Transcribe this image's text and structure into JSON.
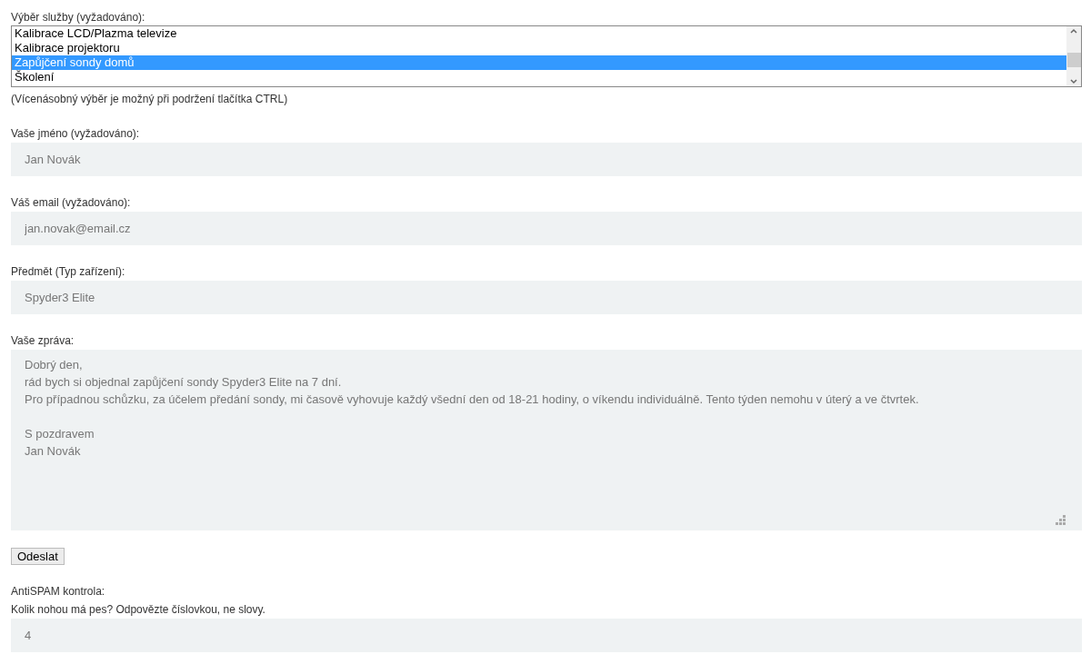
{
  "service_select": {
    "label": "Výběr služby (vyžadováno):",
    "options": [
      {
        "label": "Kalibrace LCD/Plazma televize",
        "selected": false
      },
      {
        "label": "Kalibrace projektoru",
        "selected": false
      },
      {
        "label": "Zapůjčení sondy domů",
        "selected": true
      },
      {
        "label": "Školení",
        "selected": false
      }
    ],
    "hint": "(Vícenásobný výběr je možný při podržení tlačítka CTRL)"
  },
  "fields": [
    {
      "label": "Vaše jméno (vyžadováno):",
      "value": "Jan Novák"
    },
    {
      "label": "Váš email (vyžadováno):",
      "value": "jan.novak@email.cz"
    },
    {
      "label": "Předmět (Typ zařízení):",
      "value": "Spyder3 Elite"
    }
  ],
  "message": {
    "label": "Vaše zpráva:",
    "value": "Dobrý den,\nrád bych si objednal zapůjčení sondy Spyder3 Elite na 7 dní.\nPro případnou schůzku, za účelem předání sondy, mi časově vyhovuje každý všední den od 18-21 hodiny, o víkendu individuálně. Tento týden nemohu v úterý a ve čtvrtek.\n\nS pozdravem\nJan Novák"
  },
  "submit_button": "Odeslat",
  "antispam": {
    "label": "AntiSPAM kontrola:",
    "question": "Kolik nohou má pes? Odpovězte číslovkou, ne slovy.",
    "value": "4"
  }
}
